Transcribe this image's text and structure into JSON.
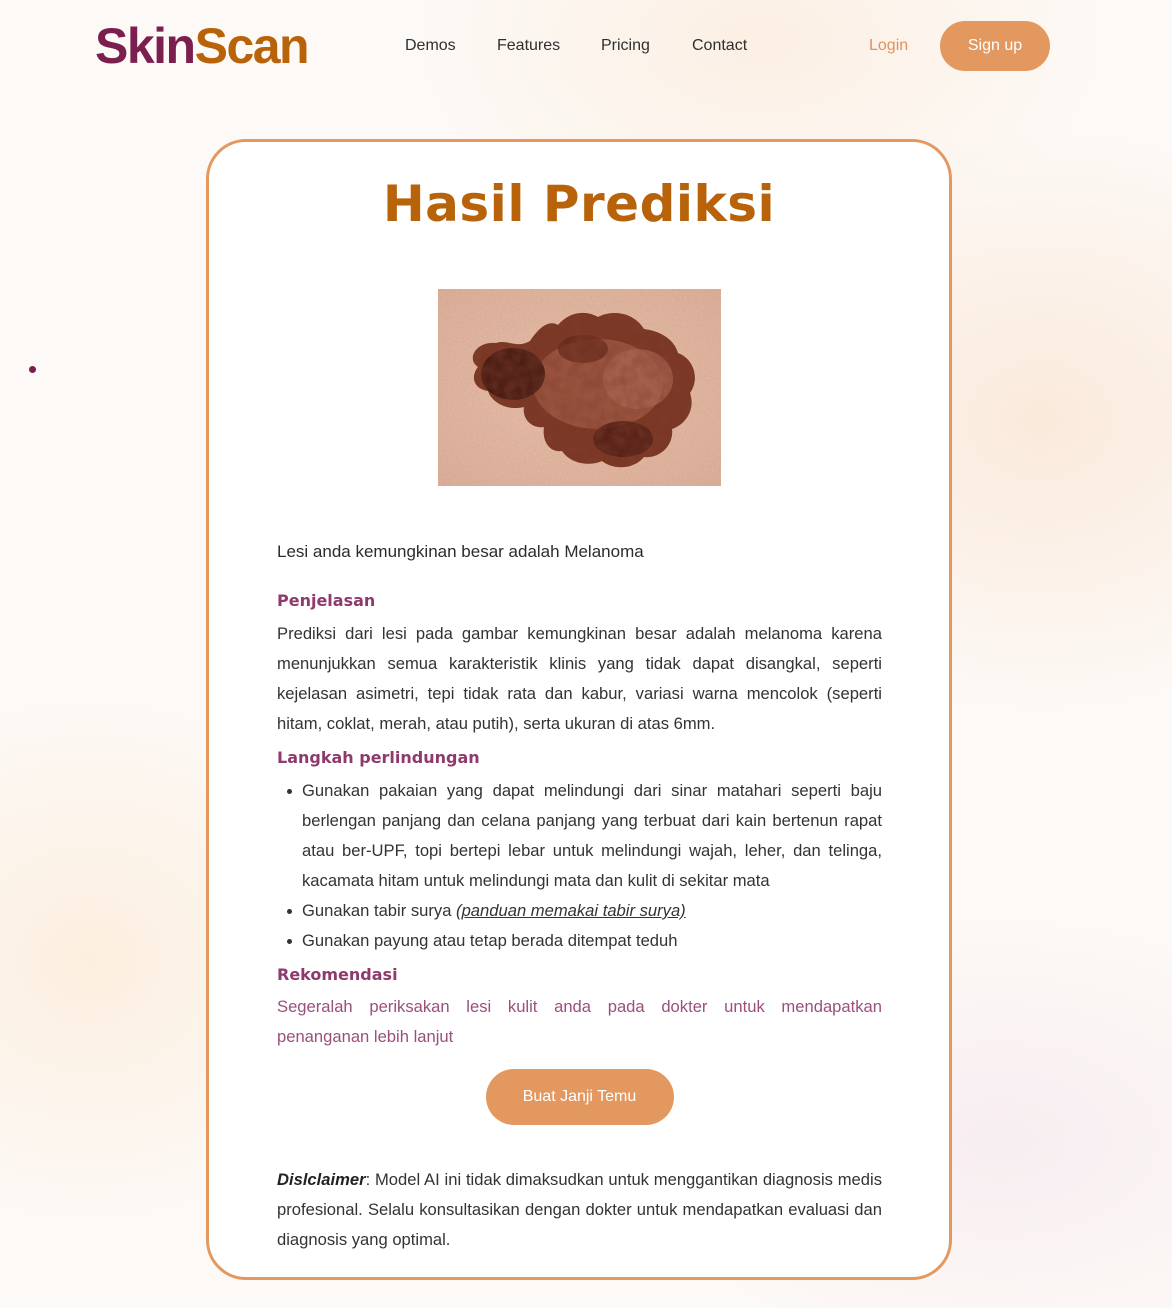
{
  "brand": {
    "part1": "Skin",
    "part2": "Scan"
  },
  "nav": {
    "links": [
      "Demos",
      "Features",
      "Pricing",
      "Contact"
    ],
    "login": "Login",
    "signup": "Sign up"
  },
  "card": {
    "title": "Hasil Prediksi",
    "prediction": "Lesi anda kemungkinan besar adalah Melanoma",
    "explanation": {
      "heading": "Penjelasan",
      "text": "Prediksi dari lesi pada gambar kemungkinan besar adalah melanoma karena menunjukkan semua karakteristik klinis yang tidak dapat disangkal, seperti kejelasan asimetri, tepi tidak rata dan kabur, variasi warna mencolok (seperti hitam, coklat, merah, atau putih), serta ukuran di atas 6mm."
    },
    "protection": {
      "heading": "Langkah perlindungan",
      "items": [
        "Gunakan pakaian yang dapat melindungi dari sinar matahari seperti baju berlengan panjang dan celana panjang yang terbuat dari kain bertenun rapat atau ber-UPF, topi bertepi lebar untuk melindungi wajah, leher, dan telinga, kacamata hitam untuk melindungi mata dan kulit di sekitar mata",
        "Gunakan tabir surya ",
        "Gunakan payung atau tetap berada ditempat teduh"
      ],
      "sunscreen_link": "(panduan memakai tabir surya)"
    },
    "recommendation": {
      "heading": "Rekomendasi",
      "text": "Segeralah periksakan lesi kulit anda pada dokter untuk mendapatkan penanganan lebih lanjut"
    },
    "appointment_button": "Buat Janji Temu",
    "disclaimer": {
      "label": "Dislclaimer",
      "text": ": Model AI ini tidak dimaksudkan untuk menggantikan diagnosis medis profesional. Selalu konsultasikan dengan dokter untuk mendapatkan evaluasi dan diagnosis yang optimal."
    }
  },
  "colors": {
    "brand_purple": "#7b1f4f",
    "brand_orange": "#b8620a",
    "accent": "#e39860",
    "section_heading": "#8e3a6c",
    "recommendation_text": "#9a4f7c"
  }
}
